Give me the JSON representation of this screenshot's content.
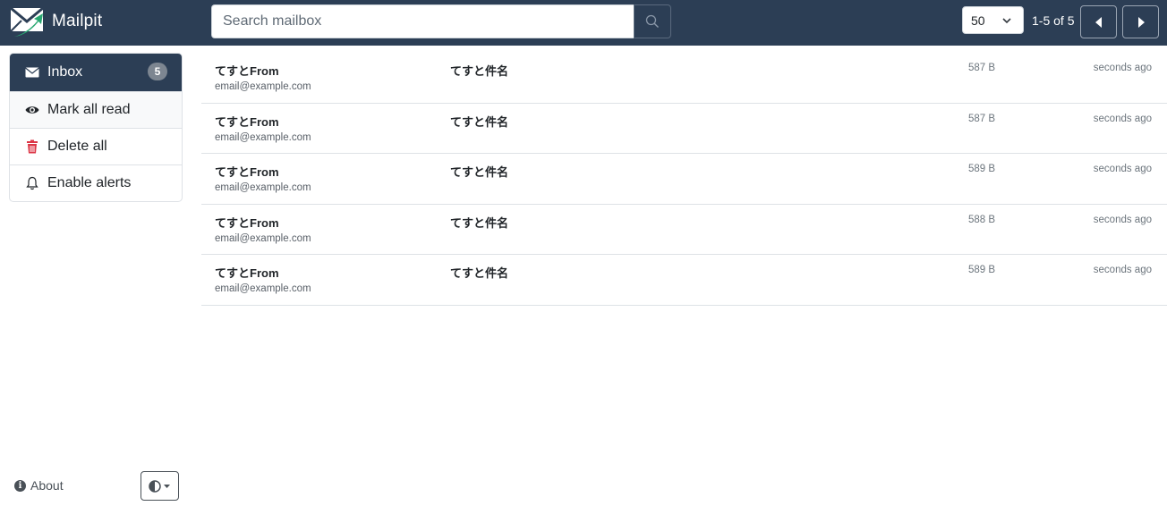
{
  "app": {
    "name": "Mailpit"
  },
  "search": {
    "placeholder": "Search mailbox"
  },
  "pagination": {
    "per_page": "50",
    "info": "1-5 of 5"
  },
  "sidebar": {
    "items": [
      {
        "label": "Inbox",
        "icon": "envelope-icon",
        "badge": "5"
      },
      {
        "label": "Mark all read",
        "icon": "eye-icon"
      },
      {
        "label": "Delete all",
        "icon": "trash-icon"
      },
      {
        "label": "Enable alerts",
        "icon": "bell-icon"
      }
    ],
    "about_label": "About",
    "theme_icon": "contrast-icon"
  },
  "colors": {
    "navbar": "#2c3e55",
    "delete_icon": "#dc3545",
    "logo_green": "#2aa872"
  },
  "messages": [
    {
      "from": "てすとFrom",
      "email": "email@example.com",
      "subject": "てすと件名",
      "size": "587 B",
      "time": "seconds ago"
    },
    {
      "from": "てすとFrom",
      "email": "email@example.com",
      "subject": "てすと件名",
      "size": "587 B",
      "time": "seconds ago"
    },
    {
      "from": "てすとFrom",
      "email": "email@example.com",
      "subject": "てすと件名",
      "size": "589 B",
      "time": "seconds ago"
    },
    {
      "from": "てすとFrom",
      "email": "email@example.com",
      "subject": "てすと件名",
      "size": "588 B",
      "time": "seconds ago"
    },
    {
      "from": "てすとFrom",
      "email": "email@example.com",
      "subject": "てすと件名",
      "size": "589 B",
      "time": "seconds ago"
    }
  ]
}
